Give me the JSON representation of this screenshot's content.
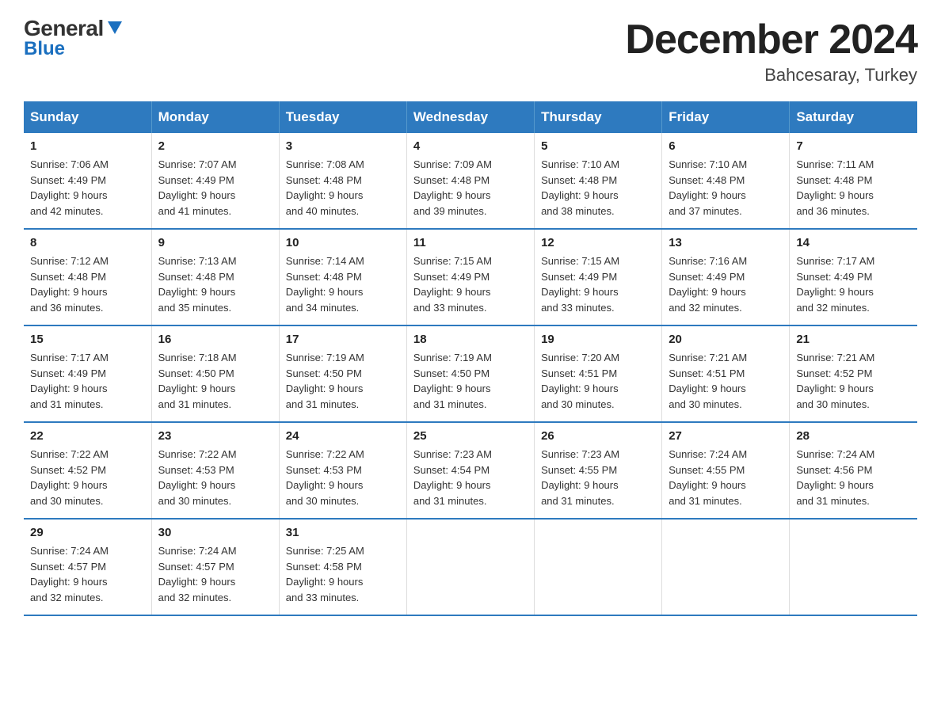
{
  "header": {
    "logo_general": "General",
    "logo_blue": "Blue",
    "month_title": "December 2024",
    "location": "Bahcesaray, Turkey"
  },
  "days_of_week": [
    "Sunday",
    "Monday",
    "Tuesday",
    "Wednesday",
    "Thursday",
    "Friday",
    "Saturday"
  ],
  "weeks": [
    [
      {
        "day": "1",
        "sunrise": "7:06 AM",
        "sunset": "4:49 PM",
        "daylight": "9 hours and 42 minutes."
      },
      {
        "day": "2",
        "sunrise": "7:07 AM",
        "sunset": "4:49 PM",
        "daylight": "9 hours and 41 minutes."
      },
      {
        "day": "3",
        "sunrise": "7:08 AM",
        "sunset": "4:48 PM",
        "daylight": "9 hours and 40 minutes."
      },
      {
        "day": "4",
        "sunrise": "7:09 AM",
        "sunset": "4:48 PM",
        "daylight": "9 hours and 39 minutes."
      },
      {
        "day": "5",
        "sunrise": "7:10 AM",
        "sunset": "4:48 PM",
        "daylight": "9 hours and 38 minutes."
      },
      {
        "day": "6",
        "sunrise": "7:10 AM",
        "sunset": "4:48 PM",
        "daylight": "9 hours and 37 minutes."
      },
      {
        "day": "7",
        "sunrise": "7:11 AM",
        "sunset": "4:48 PM",
        "daylight": "9 hours and 36 minutes."
      }
    ],
    [
      {
        "day": "8",
        "sunrise": "7:12 AM",
        "sunset": "4:48 PM",
        "daylight": "9 hours and 36 minutes."
      },
      {
        "day": "9",
        "sunrise": "7:13 AM",
        "sunset": "4:48 PM",
        "daylight": "9 hours and 35 minutes."
      },
      {
        "day": "10",
        "sunrise": "7:14 AM",
        "sunset": "4:48 PM",
        "daylight": "9 hours and 34 minutes."
      },
      {
        "day": "11",
        "sunrise": "7:15 AM",
        "sunset": "4:49 PM",
        "daylight": "9 hours and 33 minutes."
      },
      {
        "day": "12",
        "sunrise": "7:15 AM",
        "sunset": "4:49 PM",
        "daylight": "9 hours and 33 minutes."
      },
      {
        "day": "13",
        "sunrise": "7:16 AM",
        "sunset": "4:49 PM",
        "daylight": "9 hours and 32 minutes."
      },
      {
        "day": "14",
        "sunrise": "7:17 AM",
        "sunset": "4:49 PM",
        "daylight": "9 hours and 32 minutes."
      }
    ],
    [
      {
        "day": "15",
        "sunrise": "7:17 AM",
        "sunset": "4:49 PM",
        "daylight": "9 hours and 31 minutes."
      },
      {
        "day": "16",
        "sunrise": "7:18 AM",
        "sunset": "4:50 PM",
        "daylight": "9 hours and 31 minutes."
      },
      {
        "day": "17",
        "sunrise": "7:19 AM",
        "sunset": "4:50 PM",
        "daylight": "9 hours and 31 minutes."
      },
      {
        "day": "18",
        "sunrise": "7:19 AM",
        "sunset": "4:50 PM",
        "daylight": "9 hours and 31 minutes."
      },
      {
        "day": "19",
        "sunrise": "7:20 AM",
        "sunset": "4:51 PM",
        "daylight": "9 hours and 30 minutes."
      },
      {
        "day": "20",
        "sunrise": "7:21 AM",
        "sunset": "4:51 PM",
        "daylight": "9 hours and 30 minutes."
      },
      {
        "day": "21",
        "sunrise": "7:21 AM",
        "sunset": "4:52 PM",
        "daylight": "9 hours and 30 minutes."
      }
    ],
    [
      {
        "day": "22",
        "sunrise": "7:22 AM",
        "sunset": "4:52 PM",
        "daylight": "9 hours and 30 minutes."
      },
      {
        "day": "23",
        "sunrise": "7:22 AM",
        "sunset": "4:53 PM",
        "daylight": "9 hours and 30 minutes."
      },
      {
        "day": "24",
        "sunrise": "7:22 AM",
        "sunset": "4:53 PM",
        "daylight": "9 hours and 30 minutes."
      },
      {
        "day": "25",
        "sunrise": "7:23 AM",
        "sunset": "4:54 PM",
        "daylight": "9 hours and 31 minutes."
      },
      {
        "day": "26",
        "sunrise": "7:23 AM",
        "sunset": "4:55 PM",
        "daylight": "9 hours and 31 minutes."
      },
      {
        "day": "27",
        "sunrise": "7:24 AM",
        "sunset": "4:55 PM",
        "daylight": "9 hours and 31 minutes."
      },
      {
        "day": "28",
        "sunrise": "7:24 AM",
        "sunset": "4:56 PM",
        "daylight": "9 hours and 31 minutes."
      }
    ],
    [
      {
        "day": "29",
        "sunrise": "7:24 AM",
        "sunset": "4:57 PM",
        "daylight": "9 hours and 32 minutes."
      },
      {
        "day": "30",
        "sunrise": "7:24 AM",
        "sunset": "4:57 PM",
        "daylight": "9 hours and 32 minutes."
      },
      {
        "day": "31",
        "sunrise": "7:25 AM",
        "sunset": "4:58 PM",
        "daylight": "9 hours and 33 minutes."
      },
      null,
      null,
      null,
      null
    ]
  ],
  "labels": {
    "sunrise": "Sunrise:",
    "sunset": "Sunset:",
    "daylight": "Daylight:"
  }
}
